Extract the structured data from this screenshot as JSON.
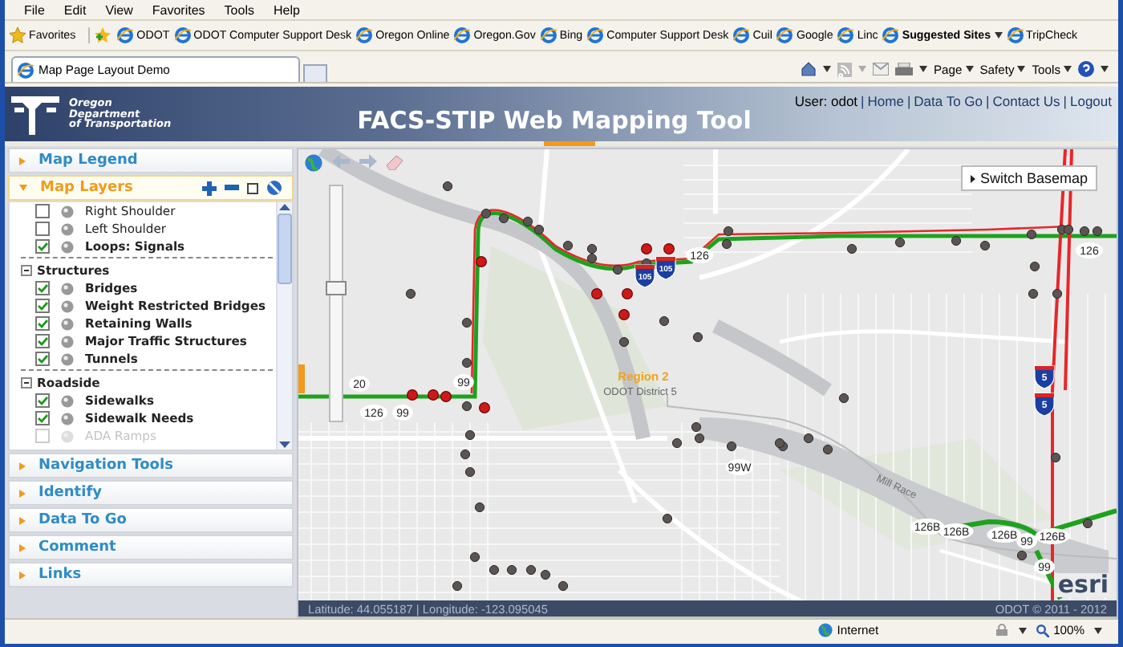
{
  "menu": [
    "File",
    "Edit",
    "View",
    "Favorites",
    "Tools",
    "Help"
  ],
  "favorites_bar": {
    "favorites": "Favorites",
    "links": [
      {
        "label": "ODOT",
        "kind": "link"
      },
      {
        "label": "ODOT Computer Support Desk",
        "kind": "link"
      },
      {
        "label": "Oregon Online",
        "kind": "link"
      },
      {
        "label": "Oregon.Gov",
        "kind": "link"
      },
      {
        "label": "Bing",
        "kind": "link"
      },
      {
        "label": "Computer Support Desk",
        "kind": "link"
      },
      {
        "label": "Cuil",
        "kind": "link"
      },
      {
        "label": "Google",
        "kind": "link"
      },
      {
        "label": "Linc",
        "kind": "link"
      },
      {
        "label": "Suggested Sites",
        "kind": "dropdown"
      },
      {
        "label": "TripCheck",
        "kind": "link"
      }
    ]
  },
  "tabs": [
    {
      "label": "Map Page Layout Demo",
      "selected": true
    }
  ],
  "command_bar": [
    "Page",
    "Safety",
    "Tools"
  ],
  "header": {
    "org": [
      "Oregon",
      "Department",
      "of Transportation"
    ],
    "title": "FACS-STIP Web Mapping Tool",
    "user": "User: odot",
    "separator": "|",
    "links": [
      "Home",
      "Data To Go",
      "Contact Us",
      "Logout"
    ]
  },
  "sidebar": {
    "sections": [
      {
        "label": "Map Legend",
        "expanded": false
      },
      {
        "label": "Map Layers",
        "expanded": true
      },
      {
        "label": "Navigation Tools",
        "expanded": false
      },
      {
        "label": "Identify",
        "expanded": false
      },
      {
        "label": "Data To Go",
        "expanded": false
      },
      {
        "label": "Comment",
        "expanded": false
      },
      {
        "label": "Links",
        "expanded": false
      }
    ],
    "layer_groups": [
      {
        "items": [
          {
            "label": "Right Shoulder",
            "checked": false,
            "disabled": false
          },
          {
            "label": "Left Shoulder",
            "checked": false,
            "disabled": false
          },
          {
            "label": "Loops: Signals",
            "checked": true,
            "disabled": false
          }
        ]
      },
      {
        "label": "Structures",
        "expanded": true,
        "items": [
          {
            "label": "Bridges",
            "checked": true,
            "disabled": false
          },
          {
            "label": "Weight Restricted Bridges",
            "checked": true,
            "disabled": false
          },
          {
            "label": "Retaining Walls",
            "checked": true,
            "disabled": false
          },
          {
            "label": "Major Traffic Structures",
            "checked": true,
            "disabled": false
          },
          {
            "label": "Tunnels",
            "checked": true,
            "disabled": false
          }
        ]
      },
      {
        "label": "Roadside",
        "expanded": true,
        "items": [
          {
            "label": "Sidewalks",
            "checked": true,
            "disabled": false
          },
          {
            "label": "Sidewalk Needs",
            "checked": true,
            "disabled": false
          },
          {
            "label": "ADA Ramps",
            "checked": false,
            "disabled": true
          }
        ]
      }
    ]
  },
  "map": {
    "switch_basemap": "Switch Basemap",
    "zoom": {
      "level": 0.57
    },
    "route_labels": [
      "126",
      "126",
      "20",
      "126",
      "99",
      "99",
      "99W",
      "126B",
      "126B",
      "126B",
      "126B",
      "99",
      "99"
    ],
    "interstate_labels": [
      "105",
      "105",
      "5",
      "5"
    ],
    "place_labels": [
      {
        "text": "Region 2",
        "kind": "region"
      },
      {
        "text": "ODOT District 5",
        "kind": "district"
      },
      {
        "text": "Mill Race",
        "kind": "water"
      }
    ],
    "attribution": "esri",
    "coordinates": "Latitude: 44.055187 | Longitude: -123.095045",
    "copyright": "ODOT © 2011 - 2012"
  },
  "status_bar": {
    "zone": "Internet",
    "zoom": "100%"
  }
}
